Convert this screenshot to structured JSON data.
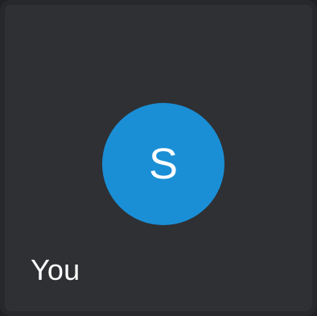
{
  "participant_tile": {
    "avatar_initial": "S",
    "name_label": "You",
    "avatar_color": "#1a8fd6",
    "tile_background": "#2f3034",
    "text_color": "#ffffff"
  }
}
